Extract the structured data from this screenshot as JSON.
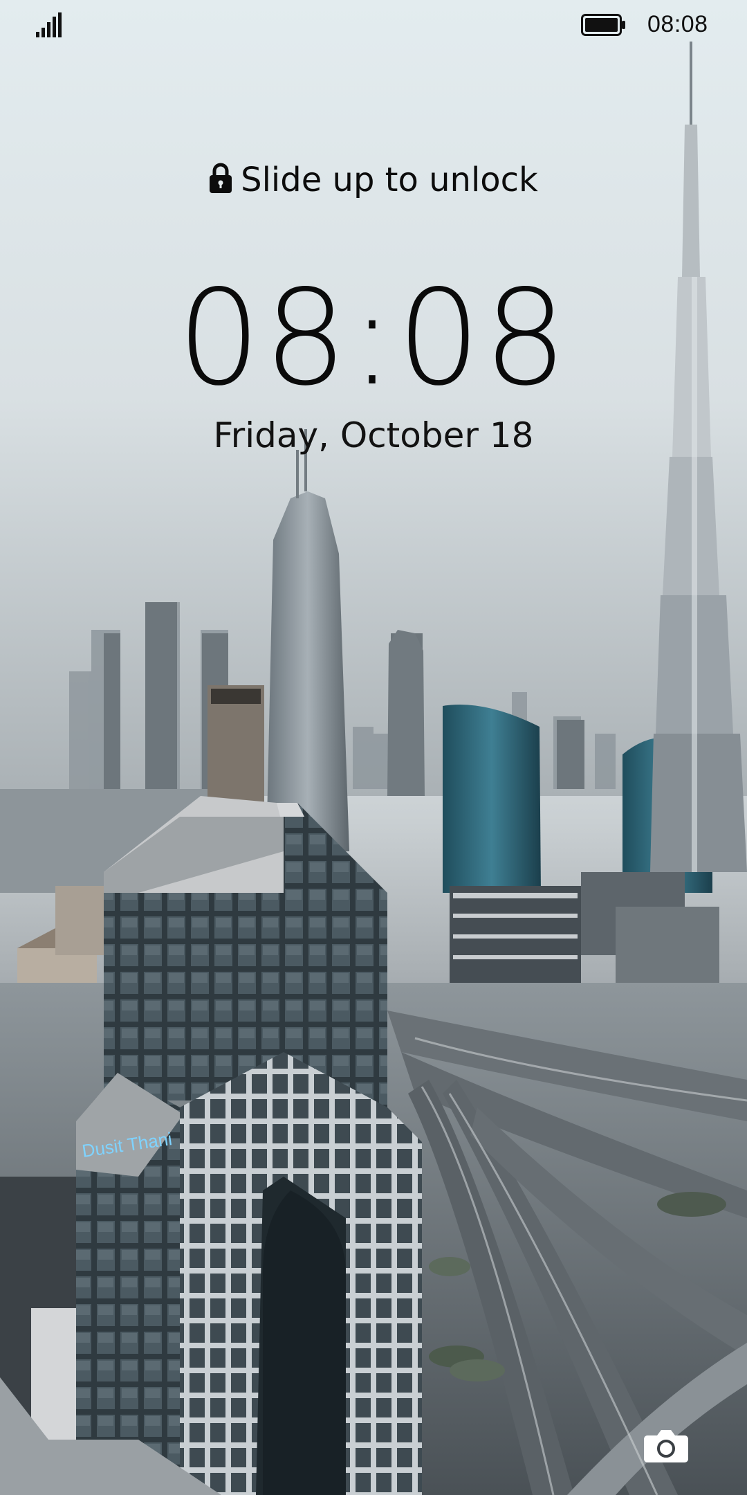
{
  "status_bar": {
    "time": "08:08",
    "signal_icon": "signal-bars-icon",
    "battery_icon": "battery-full-icon"
  },
  "lock_screen": {
    "unlock_hint": "Slide up to unlock",
    "lock_icon": "padlock-icon",
    "clock": "08:08",
    "date": "Friday, October 18",
    "camera_icon": "camera-icon"
  },
  "wallpaper": {
    "sign_text": "Dusit Thani"
  },
  "colors": {
    "text": "#0a0a0a",
    "sky_top": "#dfe9ec",
    "sky_mid": "#e9eef0",
    "city_dark": "#43494e"
  }
}
